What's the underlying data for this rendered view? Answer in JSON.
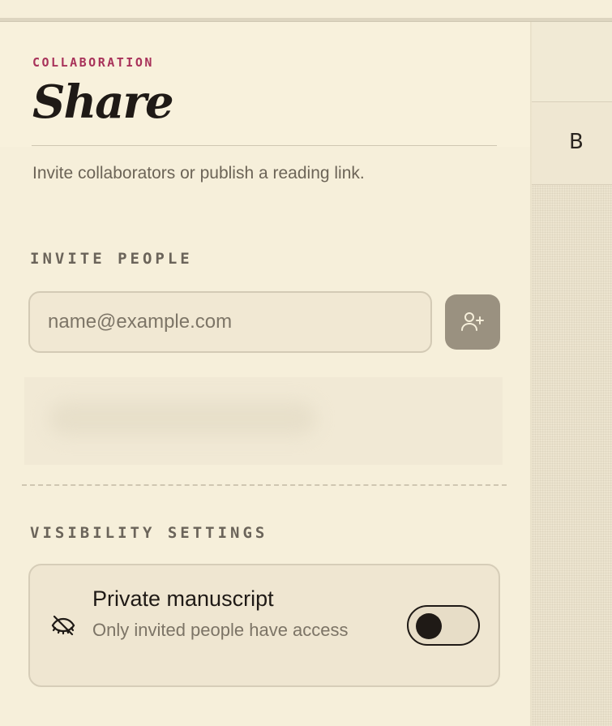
{
  "header": {
    "eyebrow": "COLLABORATION",
    "title": "Share",
    "subtitle": "Invite collaborators or publish a reading link."
  },
  "invite": {
    "section_label": "INVITE PEOPLE",
    "email_placeholder": "name@example.com",
    "email_value": "",
    "add_icon": "user-plus-icon"
  },
  "visibility": {
    "section_label": "VISIBILITY SETTINGS",
    "icon": "eye-off-icon",
    "title": "Private manuscript",
    "description": "Only invited people have access",
    "toggle_on": false
  },
  "side_toolbar": {
    "bold_label": "B"
  },
  "colors": {
    "background": "#f6efda",
    "accent": "#a8325a",
    "button": "#9a9180",
    "text_dark": "#1f1a16"
  }
}
